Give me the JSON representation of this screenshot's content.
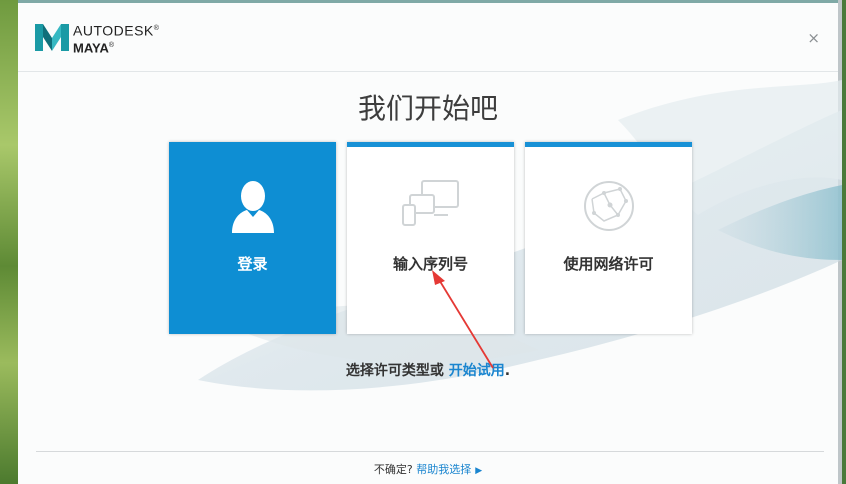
{
  "header": {
    "brand_line1": "AUTODESK",
    "brand_line2": "MAYA",
    "registered_mark": "®",
    "close_glyph": "×"
  },
  "main": {
    "title": "我们开始吧",
    "cards": [
      {
        "label": "登录",
        "icon": "user-icon",
        "active": true
      },
      {
        "label": "输入序列号",
        "icon": "devices-icon",
        "active": false
      },
      {
        "label": "使用网络许可",
        "icon": "network-globe-icon",
        "active": false
      }
    ],
    "subtext": {
      "prefix": "选择许可类型或 ",
      "link": "开始试用",
      "suffix": "."
    }
  },
  "footer": {
    "prefix": "不确定? ",
    "link": "帮助我选择",
    "arrow": "▶"
  },
  "colors": {
    "accent": "#1891d6",
    "active_card": "#0e8ed3",
    "link": "#1a85cf",
    "annotation_arrow": "#e53935"
  }
}
